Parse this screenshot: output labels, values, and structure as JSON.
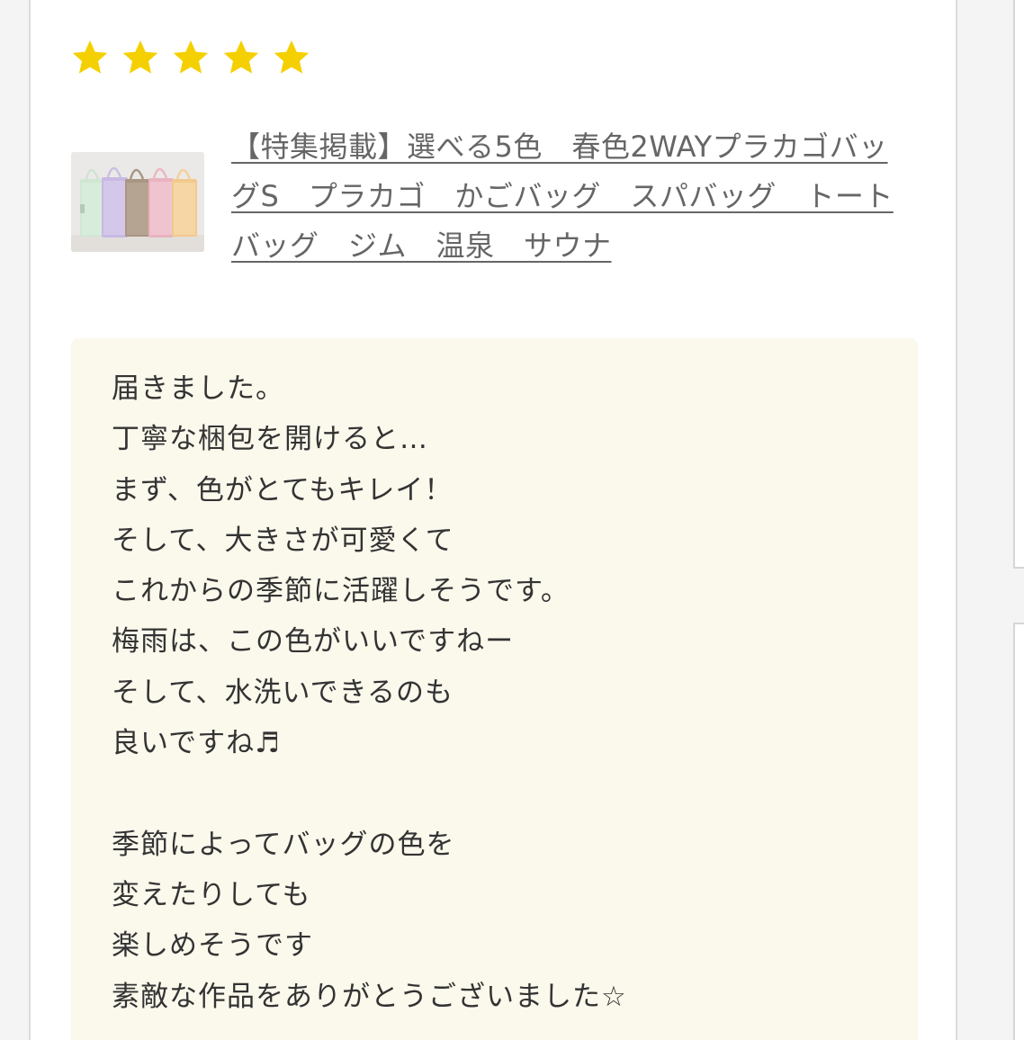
{
  "review": {
    "rating": 5,
    "max_rating": 5,
    "star_color": "#f5d000",
    "date": "",
    "product": {
      "title": "【特集掲載】選べる5色　春色2WAYプラカゴバッグS　プラカゴ　かごバッグ　スパバッグ　トートバッグ　ジム　温泉　サウナ",
      "thumbnail_alt": "5色のプラカゴバッグ"
    },
    "comment": "届きました。\n丁寧な梱包を開けると…\nまず、色がとてもキレイ！\nそして、大きさが可愛くて\nこれからの季節に活躍しそうです。\n梅雨は、この色がいいですねー\nそして、水洗いできるのも\n良いですね♬\n\n季節によってバッグの色を\n変えたりしても\n楽しめそうです\n素敵な作品をありがとうございました☆"
  }
}
